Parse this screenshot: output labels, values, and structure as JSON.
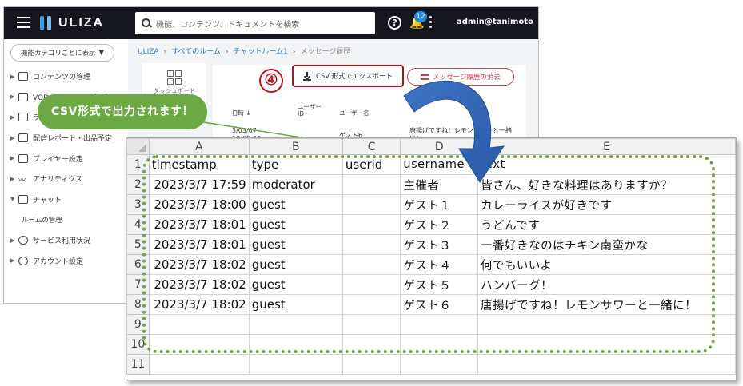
{
  "app": {
    "logo": "ULIZA",
    "search_placeholder": "機能、コンテンツ、ドキュメントを検索",
    "notification_count": "12",
    "user": "admin@tanimoto"
  },
  "sidebar": {
    "category_select": "機能カテゴリごとに表示",
    "items": [
      {
        "label": "コンテンツの管理"
      },
      {
        "label": "VOD コンテンツの登録"
      },
      {
        "label": "ライブ"
      },
      {
        "label": "配信レポート・出品予定"
      },
      {
        "label": "プレイヤー設定"
      },
      {
        "label": "アナリティクス"
      },
      {
        "label": "チャット"
      },
      {
        "label": "ルームの管理"
      },
      {
        "label": "サービス利用状況"
      },
      {
        "label": "アカウント設定"
      }
    ]
  },
  "breadcrumb": [
    "ULIZA",
    "すべてのルーム",
    "チャットルーム1",
    "メッセージ履歴"
  ],
  "dashboard_label": "ダッシュボード",
  "buttons": {
    "csv_export": "CSV 形式でエクスポート",
    "clear_history": "メッセージ履歴の消去"
  },
  "step_number": "④",
  "table_preview": {
    "col_datetime": "日時 ↓",
    "col_user_id": "ユーザー ID",
    "col_user_name": "ユーザー名",
    "row_datetime": "3/03/07 18:02:46",
    "row_username": "ゲスト6",
    "row_message": "唐揚げですね！レモンサワーと一緒に！"
  },
  "callout": "CSV形式で出力されます！",
  "spreadsheet": {
    "columns": [
      "A",
      "B",
      "C",
      "D",
      "E"
    ],
    "rows": [
      {
        "n": "1",
        "a": "timestamp",
        "b": "type",
        "c": "userid",
        "d": "username",
        "e": "text"
      },
      {
        "n": "2",
        "a": "2023/3/7 17:59",
        "b": "moderator",
        "c": "",
        "d": "主催者",
        "e": "皆さん、好きな料理はありますか？"
      },
      {
        "n": "3",
        "a": "2023/3/7 18:00",
        "b": "guest",
        "c": "",
        "d": "ゲスト１",
        "e": "カレーライスが好きです"
      },
      {
        "n": "4",
        "a": "2023/3/7 18:01",
        "b": "guest",
        "c": "",
        "d": "ゲスト２",
        "e": "うどんです"
      },
      {
        "n": "5",
        "a": "2023/3/7 18:01",
        "b": "guest",
        "c": "",
        "d": "ゲスト３",
        "e": "一番好きなのはチキン南蛮かな"
      },
      {
        "n": "6",
        "a": "2023/3/7 18:02",
        "b": "guest",
        "c": "",
        "d": "ゲスト４",
        "e": "何でもいいよ"
      },
      {
        "n": "7",
        "a": "2023/3/7 18:02",
        "b": "guest",
        "c": "",
        "d": "ゲスト５",
        "e": "ハンバーグ！"
      },
      {
        "n": "8",
        "a": "2023/3/7 18:02",
        "b": "guest",
        "c": "",
        "d": "ゲスト６",
        "e": "唐揚げですね！レモンサワーと一緒に！"
      },
      {
        "n": "9",
        "a": "",
        "b": "",
        "c": "",
        "d": "",
        "e": ""
      },
      {
        "n": "10",
        "a": "",
        "b": "",
        "c": "",
        "d": "",
        "e": ""
      },
      {
        "n": "11",
        "a": "",
        "b": "",
        "c": "",
        "d": "",
        "e": ""
      }
    ]
  },
  "colors": {
    "header_bg": "#16161e",
    "accent_blue": "#39a6e3",
    "callout_green": "#6ca844",
    "highlight_red": "#b3121b",
    "arrow_blue": "#2f63b5"
  }
}
